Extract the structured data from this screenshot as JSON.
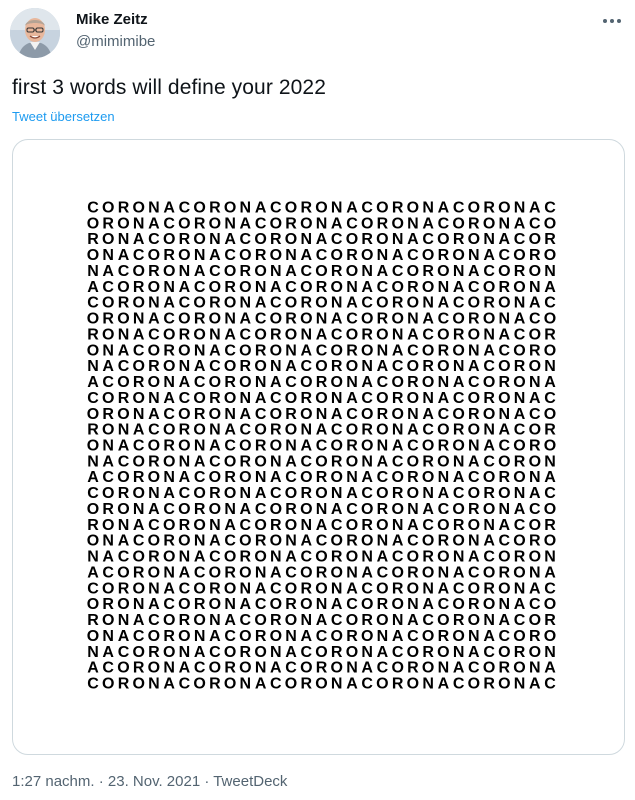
{
  "author": {
    "name": "Mike Zeitz",
    "handle": "@mimimibe"
  },
  "tweet": {
    "text": "first 3 words will define your 2022",
    "translate_label": "Tweet übersetzen"
  },
  "media": {
    "word": "CORONA",
    "pattern_note": "Grid of letters spelling CORONA repeatedly; each row continues the sequence, offset by one letter per row",
    "rows": 31,
    "columns": 31,
    "rows_text": [
      "CORONACORONACORONACORONACORONAC",
      "ORONACORONACORONACORONACORONACO",
      "RONACORONACORONACORONACORONACOR",
      "ONACORONACORONACORONACORONACORO",
      "NACORONACORONACORONACORONACORON",
      "ACORONACORONACORONACORONACORONA",
      "CORONACORONACORONACORONACORONAC",
      "ORONACORONACORONACORONACORONACO",
      "RONACORONACORONACORONACORONACOR",
      "ONACORONACORONACORONACORONACORO",
      "NACORONACORONACORONACORONACORON",
      "ACORONACORONACORONACORONACORONA",
      "CORONACORONACORONACORONACORONAC",
      "ORONACORONACORONACORONACORONACO",
      "RONACORONACORONACORONACORONACOR",
      "ONACORONACORONACORONACORONACORO",
      "NACORONACORONACORONACORONACORON",
      "ACORONACORONACORONACORONACORONA",
      "CORONACORONACORONACORONACORONAC",
      "ORONACORONACORONACORONACORONACO",
      "RONACORONACORONACORONACORONACOR",
      "ONACORONACORONACORONACORONACORO",
      "NACORONACORONACORONACORONACORON",
      "ACORONACORONACORONACORONACORONA",
      "CORONACORONACORONACORONACORONAC",
      "ORONACORONACORONACORONACORONACO",
      "RONACORONACORONACORONACORONACOR",
      "ONACORONACORONACORONACORONACORO",
      "NACORONACORONACORONACORONACORON",
      "ACORONACORONACORONACORONACORONA",
      "CORONACORONACORONACORONACORONAC"
    ]
  },
  "meta": {
    "text": "1:27 nachm. · 23. Nov. 2021 · TweetDeck"
  },
  "icons": {
    "avatar": "user-photo-icon",
    "more": "more-horizontal-icon"
  },
  "colors": {
    "text_primary": "#0f1419",
    "text_secondary": "#536471",
    "link": "#1d9bf0",
    "border": "#cfd9de"
  }
}
